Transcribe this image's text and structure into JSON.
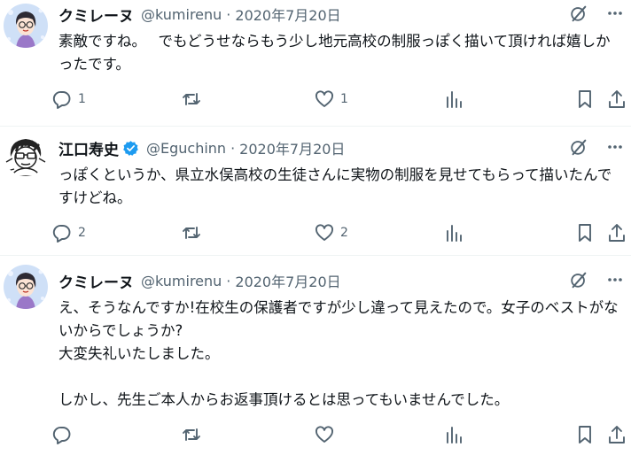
{
  "tweets": [
    {
      "name": "クミレーヌ",
      "handle": "@kumirenu",
      "separator": "·",
      "date": "2020年7月20日",
      "verified": false,
      "text": "素敵ですね。　 でもどうせならもう少し地元高校の制服っぽく描いて頂ければ嬉しかったです。",
      "reply_count": "1",
      "retweet_count": "",
      "like_count": "1"
    },
    {
      "name": "江口寿史",
      "handle": "@Eguchinn",
      "separator": "·",
      "date": "2020年7月20日",
      "verified": true,
      "text": "っぽくというか、県立水俣高校の生徒さんに実物の制服を見せてもらって描いたんですけどね。",
      "reply_count": "2",
      "retweet_count": "",
      "like_count": "2"
    },
    {
      "name": "クミレーヌ",
      "handle": "@kumirenu",
      "separator": "·",
      "date": "2020年7月20日",
      "verified": false,
      "text": "え、そうなんですか!在校生の保護者ですが少し違って見えたので。女子のベストがないからでしょうか?\n大変失礼いたしました。\n\nしかし、先生ご本人からお返事頂けるとは思ってもいませんでした。",
      "reply_count": "",
      "retweet_count": "",
      "like_count": ""
    }
  ],
  "icons": {
    "grok": "grok-icon",
    "more": "more-icon",
    "reply": "reply-icon",
    "retweet": "retweet-icon",
    "like": "like-icon",
    "views": "views-icon",
    "bookmark": "bookmark-icon",
    "share": "share-icon",
    "verified": "verified-badge-icon"
  },
  "colors": {
    "text": "#0f1419",
    "secondary": "#536471",
    "verified": "#1d9bf0",
    "border": "#eff3f4"
  }
}
